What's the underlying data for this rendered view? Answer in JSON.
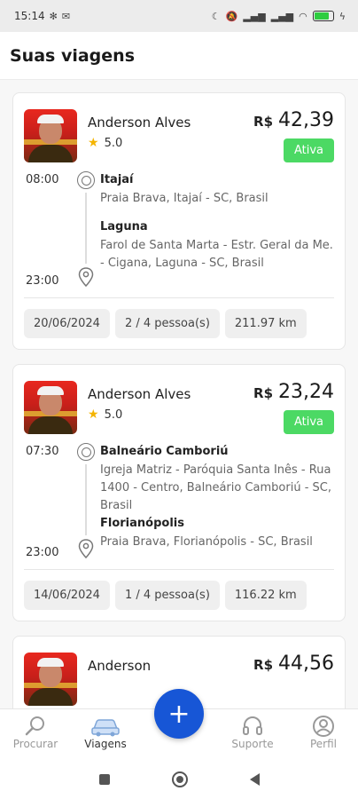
{
  "status_bar": {
    "time": "15:14",
    "battery_color": "#2ecc40"
  },
  "header": {
    "title": "Suas viagens"
  },
  "trips": [
    {
      "driver": "Anderson Alves",
      "rating": "5.0",
      "currency": "R$",
      "price": "42,39",
      "status": "Ativa",
      "departure_time": "08:00",
      "origin_city": "Itajaí",
      "origin_address": "Praia Brava, Itajaí - SC, Brasil",
      "arrival_time": "23:00",
      "destination_city": "Laguna",
      "destination_address": "Farol de Santa Marta - Estr. Geral da Me. - Cigana, Laguna - SC, Brasil",
      "date": "20/06/2024",
      "seats": "2 / 4 pessoa(s)",
      "distance": "211.97 km"
    },
    {
      "driver": "Anderson Alves",
      "rating": "5.0",
      "currency": "R$",
      "price": "23,24",
      "status": "Ativa",
      "departure_time": "07:30",
      "origin_city": "Balneário Camboriú",
      "origin_address": "Igreja Matriz - Paróquia Santa Inês - Rua 1400 - Centro, Balneário Camboriú - SC, Brasil",
      "arrival_time": "23:00",
      "destination_city": "Florianópolis",
      "destination_address": "Praia Brava, Florianópolis - SC, Brasil",
      "date": "14/06/2024",
      "seats": "1 / 4 pessoa(s)",
      "distance": "116.22 km"
    },
    {
      "driver": "Anderson",
      "currency": "R$",
      "price": "44,56"
    }
  ],
  "bottom_nav": {
    "items": [
      {
        "label": "Procurar",
        "icon": "search-icon"
      },
      {
        "label": "Viagens",
        "icon": "car-icon"
      },
      {
        "label": "Suporte",
        "icon": "headset-icon"
      },
      {
        "label": "Perfil",
        "icon": "profile-icon"
      }
    ],
    "fab_icon": "plus-icon",
    "accent_color": "#1756d6"
  },
  "colors": {
    "status_badge": "#4cd964",
    "rating_star": "#f4b400"
  }
}
